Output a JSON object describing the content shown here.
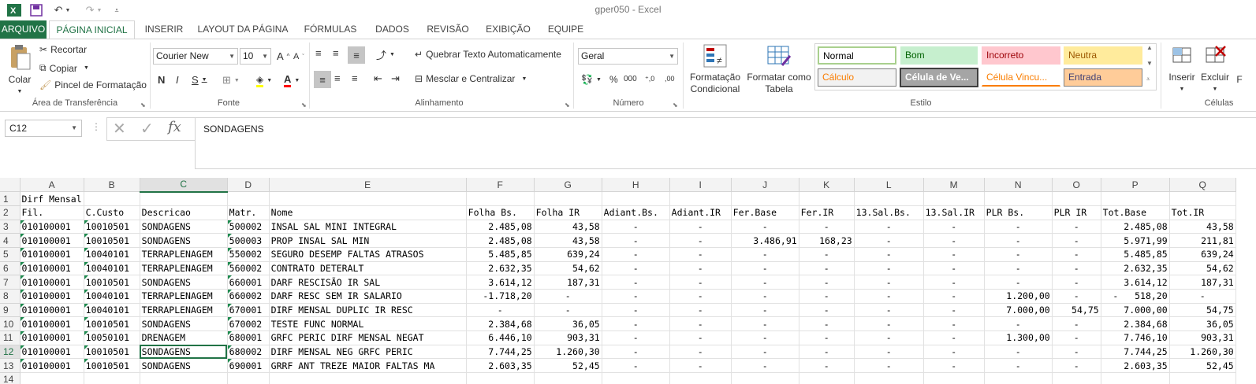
{
  "window": {
    "title": "gper050 - Excel"
  },
  "quick_access": {
    "icons": [
      "excel-logo-icon",
      "save-icon",
      "undo-icon",
      "redo-icon",
      "customize-icon"
    ]
  },
  "tabs": [
    {
      "label": "ARQUIVO"
    },
    {
      "label": "PÁGINA INICIAL"
    },
    {
      "label": "INSERIR"
    },
    {
      "label": "LAYOUT DA PÁGINA"
    },
    {
      "label": "FÓRMULAS"
    },
    {
      "label": "DADOS"
    },
    {
      "label": "REVISÃO"
    },
    {
      "label": "EXIBIÇÃO"
    },
    {
      "label": "EQUIPE"
    }
  ],
  "ribbon": {
    "clipboard": {
      "paste": "Colar",
      "cut": "Recortar",
      "copy": "Copiar",
      "format_painter": "Pincel de Formatação",
      "label": "Área de Transferência"
    },
    "font": {
      "name": "Courier New",
      "size": "10",
      "label": "Fonte"
    },
    "alignment": {
      "wrap": "Quebrar Texto Automaticamente",
      "merge": "Mesclar e Centralizar",
      "label": "Alinhamento"
    },
    "number": {
      "format": "Geral",
      "label": "Número"
    },
    "style": {
      "conditional": "Formatação Condicional",
      "format_table": "Formatar como Tabela",
      "label": "Estilo",
      "cells": [
        {
          "text": "Normal",
          "bg": "#ffffff",
          "color": "#000000",
          "border": "#a9d08e"
        },
        {
          "text": "Bom",
          "bg": "#c6efce",
          "color": "#006100",
          "border": "#c6efce"
        },
        {
          "text": "Incorreto",
          "bg": "#ffc7ce",
          "color": "#9c0006",
          "border": "#ffc7ce"
        },
        {
          "text": "Neutra",
          "bg": "#ffeb9c",
          "color": "#9c5700",
          "border": "#ffeb9c"
        },
        {
          "text": "Cálculo",
          "bg": "#f2f2f2",
          "color": "#fa7d00",
          "border": "#7f7f7f"
        },
        {
          "text": "Célula de Ve...",
          "bg": "#a5a5a5",
          "color": "#ffffff",
          "border": "#3f3f3f"
        },
        {
          "text": "Célula Vincu...",
          "bg": "#ffffff",
          "color": "#fa7d00",
          "border": "#ffffff"
        },
        {
          "text": "Entrada",
          "bg": "#ffcc99",
          "color": "#3f3f76",
          "border": "#7f7f7f"
        }
      ]
    },
    "cells": {
      "insert": "Inserir",
      "delete": "Excluir",
      "format": "F",
      "label": "Células"
    }
  },
  "formula_bar": {
    "name_box": "C12",
    "content": "SONDAGENS"
  },
  "columns": [
    "A",
    "B",
    "C",
    "D",
    "E",
    "F",
    "G",
    "H",
    "I",
    "J",
    "K",
    "L",
    "M",
    "N",
    "O",
    "P",
    "Q"
  ],
  "rows": [
    {
      "n": "1",
      "cells": [
        "Dirf Mensal",
        "",
        "",
        "",
        "",
        "",
        "",
        "",
        "",
        "",
        "",
        "",
        "",
        "",
        "",
        "",
        ""
      ]
    },
    {
      "n": "2",
      "cells": [
        "Fil.",
        "C.Custo",
        "Descricao",
        "Matr.",
        "Nome",
        "Folha Bs.",
        "Folha IR",
        "Adiant.Bs.",
        "Adiant.IR",
        "Fer.Base",
        "Fer.IR",
        "13.Sal.Bs.",
        "13.Sal.IR",
        "PLR Bs.",
        "PLR IR",
        "Tot.Base",
        "Tot.IR"
      ]
    },
    {
      "n": "3",
      "cells": [
        "010100001",
        "10010501",
        "SONDAGENS",
        "500002",
        "INSAL SAL MINI INTEGRAL",
        "2.485,08",
        "43,58",
        "-",
        "-",
        "-",
        "-",
        "-",
        "-",
        "-",
        "-",
        "2.485,08",
        "43,58"
      ]
    },
    {
      "n": "4",
      "cells": [
        "010100001",
        "10010501",
        "SONDAGENS",
        "500003",
        "PROP INSAL SAL MIN",
        "2.485,08",
        "43,58",
        "-",
        "-",
        "3.486,91",
        "168,23",
        "-",
        "-",
        "-",
        "-",
        "5.971,99",
        "211,81"
      ]
    },
    {
      "n": "5",
      "cells": [
        "010100001",
        "10040101",
        "TERRAPLENAGEM",
        "550002",
        "SEGURO DESEMP FALTAS ATRASOS",
        "5.485,85",
        "639,24",
        "-",
        "-",
        "-",
        "-",
        "-",
        "-",
        "-",
        "-",
        "5.485,85",
        "639,24"
      ]
    },
    {
      "n": "6",
      "cells": [
        "010100001",
        "10040101",
        "TERRAPLENAGEM",
        "560002",
        "CONTRATO DETERALT",
        "2.632,35",
        "54,62",
        "-",
        "-",
        "-",
        "-",
        "-",
        "-",
        "-",
        "-",
        "2.632,35",
        "54,62"
      ]
    },
    {
      "n": "7",
      "cells": [
        "010100001",
        "10010501",
        "SONDAGENS",
        "660001",
        "DARF RESCISÃO IR SAL",
        "3.614,12",
        "187,31",
        "-",
        "-",
        "-",
        "-",
        "-",
        "-",
        "-",
        "-",
        "3.614,12",
        "187,31"
      ]
    },
    {
      "n": "8",
      "cells": [
        "010100001",
        "10040101",
        "TERRAPLENAGEM",
        "660002",
        "DARF RESC SEM IR SALARIO",
        "-1.718,20",
        "-",
        "-",
        "-",
        "-",
        "-",
        "-",
        "-",
        "1.200,00",
        "-",
        "-   518,20",
        "-"
      ]
    },
    {
      "n": "9",
      "cells": [
        "010100001",
        "10040101",
        "TERRAPLENAGEM",
        "670001",
        "DIRF MENSAL DUPLIC IR RESC",
        "-",
        "-",
        "-",
        "-",
        "-",
        "-",
        "-",
        "-",
        "7.000,00",
        "54,75",
        "7.000,00",
        "54,75"
      ]
    },
    {
      "n": "10",
      "cells": [
        "010100001",
        "10010501",
        "SONDAGENS",
        "670002",
        "TESTE FUNC NORMAL",
        "2.384,68",
        "36,05",
        "-",
        "-",
        "-",
        "-",
        "-",
        "-",
        "-",
        "-",
        "2.384,68",
        "36,05"
      ]
    },
    {
      "n": "11",
      "cells": [
        "010100001",
        "10050101",
        "DRENAGEM",
        "680001",
        "GRFC PERIC DIRF MENSAL NEGAT",
        "6.446,10",
        "903,31",
        "-",
        "-",
        "-",
        "-",
        "-",
        "-",
        "1.300,00",
        "-",
        "7.746,10",
        "903,31"
      ]
    },
    {
      "n": "12",
      "cells": [
        "010100001",
        "10010501",
        "SONDAGENS",
        "680002",
        "DIRF MENSAL NEG GRFC PERIC",
        "7.744,25",
        "1.260,30",
        "-",
        "-",
        "-",
        "-",
        "-",
        "-",
        "-",
        "-",
        "7.744,25",
        "1.260,30"
      ]
    },
    {
      "n": "13",
      "cells": [
        "010100001",
        "10010501",
        "SONDAGENS",
        "690001",
        "GRRF ANT TREZE MAIOR FALTAS MA",
        "2.603,35",
        "52,45",
        "-",
        "-",
        "-",
        "-",
        "-",
        "-",
        "-",
        "-",
        "2.603,35",
        "52,45"
      ]
    },
    {
      "n": "14",
      "cells": [
        "",
        "",
        "",
        "",
        "",
        "",
        "",
        "",
        "",
        "",
        "",
        "",
        "",
        "",
        "",
        "",
        ""
      ]
    }
  ]
}
